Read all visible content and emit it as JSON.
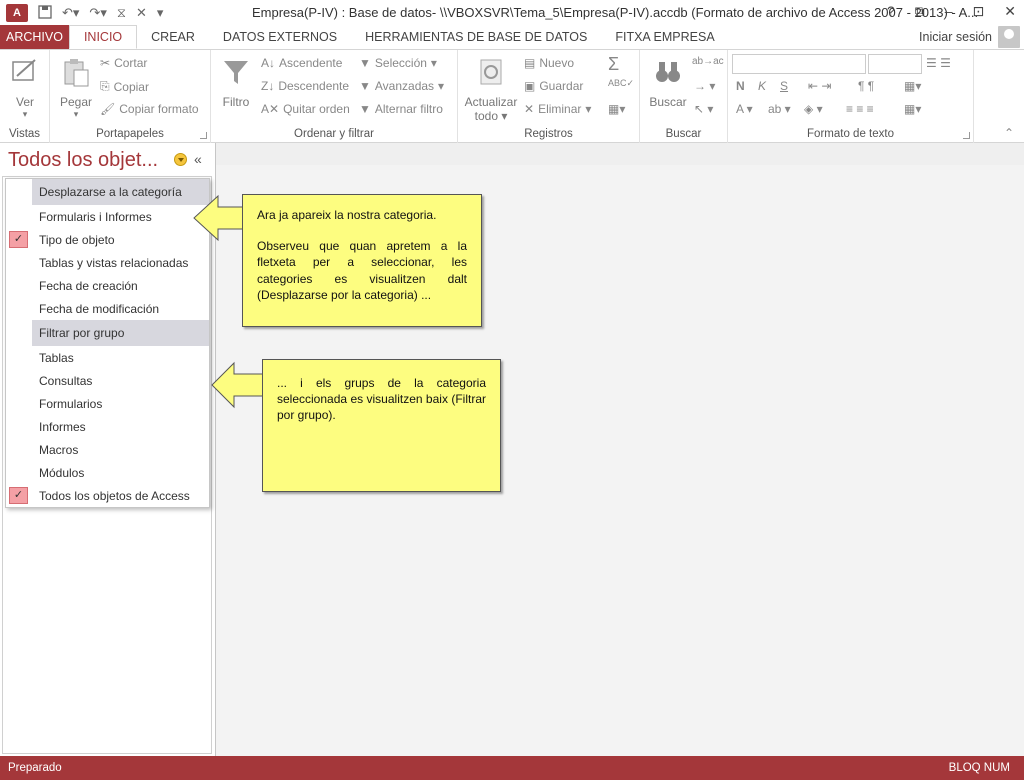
{
  "titlebar": {
    "app_badge": "A",
    "title": "Empresa(P-IV) : Base de datos- \\\\VBOXSVR\\Tema_5\\Empresa(P-IV).accdb (Formato de archivo de Access 2007 - 2013) - A...",
    "controls": [
      "?",
      "⧉",
      "–",
      "⊡",
      "✕"
    ]
  },
  "tabs": [
    "ARCHIVO",
    "INICIO",
    "CREAR",
    "DATOS EXTERNOS",
    "HERRAMIENTAS DE BASE DE DATOS",
    "FITXA EMPRESA"
  ],
  "signin": "Iniciar sesión",
  "ribbon": {
    "vistas": {
      "label": "Vistas",
      "ver": "Ver"
    },
    "portapapeles": {
      "label": "Portapapeles",
      "pegar": "Pegar",
      "cortar": "Cortar",
      "copiar": "Copiar",
      "copiar_formato": "Copiar formato"
    },
    "ordenar": {
      "label": "Ordenar y filtrar",
      "filtro": "Filtro",
      "ascendente": "Ascendente",
      "descendente": "Descendente",
      "quitar_orden": "Quitar orden",
      "seleccion": "Selección",
      "avanzadas": "Avanzadas",
      "alternar": "Alternar filtro"
    },
    "registros": {
      "label": "Registros",
      "actualizar": "Actualizar",
      "todo": "todo",
      "nuevo": "Nuevo",
      "guardar": "Guardar",
      "eliminar": "Eliminar"
    },
    "buscar": {
      "label": "Buscar",
      "buscar": "Buscar"
    },
    "formato": {
      "label": "Formato de texto"
    }
  },
  "navpane": {
    "title": "Todos los objet...",
    "menu": [
      {
        "type": "section",
        "label": "Desplazarse a la categoría"
      },
      {
        "type": "item",
        "label": "Formularis i Informes",
        "checked": false
      },
      {
        "type": "item",
        "label": "Tipo de objeto",
        "checked": true
      },
      {
        "type": "item",
        "label": "Tablas y vistas relacionadas",
        "checked": false
      },
      {
        "type": "item",
        "label": "Fecha de creación",
        "checked": false
      },
      {
        "type": "item",
        "label": "Fecha de modificación",
        "checked": false
      },
      {
        "type": "section",
        "label": "Filtrar por grupo"
      },
      {
        "type": "item",
        "label": "Tablas",
        "checked": false
      },
      {
        "type": "item",
        "label": "Consultas",
        "checked": false
      },
      {
        "type": "item",
        "label": "Formularios",
        "checked": false
      },
      {
        "type": "item",
        "label": "Informes",
        "checked": false
      },
      {
        "type": "item",
        "label": "Macros",
        "checked": false
      },
      {
        "type": "item",
        "label": "Módulos",
        "checked": false
      },
      {
        "type": "item",
        "label": "Todos los objetos de Access",
        "checked": true
      }
    ]
  },
  "callouts": {
    "top_line1": "Ara ja apareix la nostra categoria.",
    "top_line2": "Observeu que quan apretem a la fletxeta per a seleccionar, les categories es visualitzen dalt (Desplazarse por la categoria) ...",
    "bottom": "... i els grups de la categoria seleccionada es visualitzen baix (Filtrar por grupo)."
  },
  "statusbar": {
    "left": "Preparado",
    "right": "BLOQ NUM"
  }
}
